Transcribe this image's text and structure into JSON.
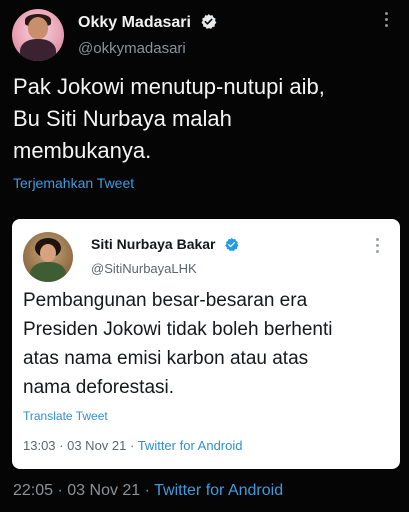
{
  "outer_tweet": {
    "author_name": "Okky Madasari",
    "author_handle": "@okkymadasari",
    "text": "Pak Jokowi menutup-nutupi aib,\nBu Siti Nurbaya malah\nmembukanya.",
    "translate_label": "Terjemahkan Tweet",
    "time": "22:05",
    "separator": " · ",
    "date": "03 Nov 21",
    "source": "Twitter for Android"
  },
  "quoted_tweet": {
    "author_name": "Siti Nurbaya Bakar",
    "author_handle": "@SitiNurbayaLHK",
    "text": "Pembangunan besar-besaran era\nPresiden Jokowi tidak boleh berhenti\natas nama emisi karbon atau atas\nnama deforestasi.",
    "translate_label": "Translate Tweet",
    "time": "13:03",
    "separator": " · ",
    "date": "03 Nov 21",
    "source": "Twitter for Android"
  },
  "icons": {
    "verified": "verified-badge-icon",
    "more": "more-options-icon"
  },
  "colors": {
    "background": "#050505",
    "link": "#3f9ae0",
    "verified_outer": "#e7e9ea",
    "verified_inner": "#1d9bf0",
    "card": "#ffffff"
  }
}
